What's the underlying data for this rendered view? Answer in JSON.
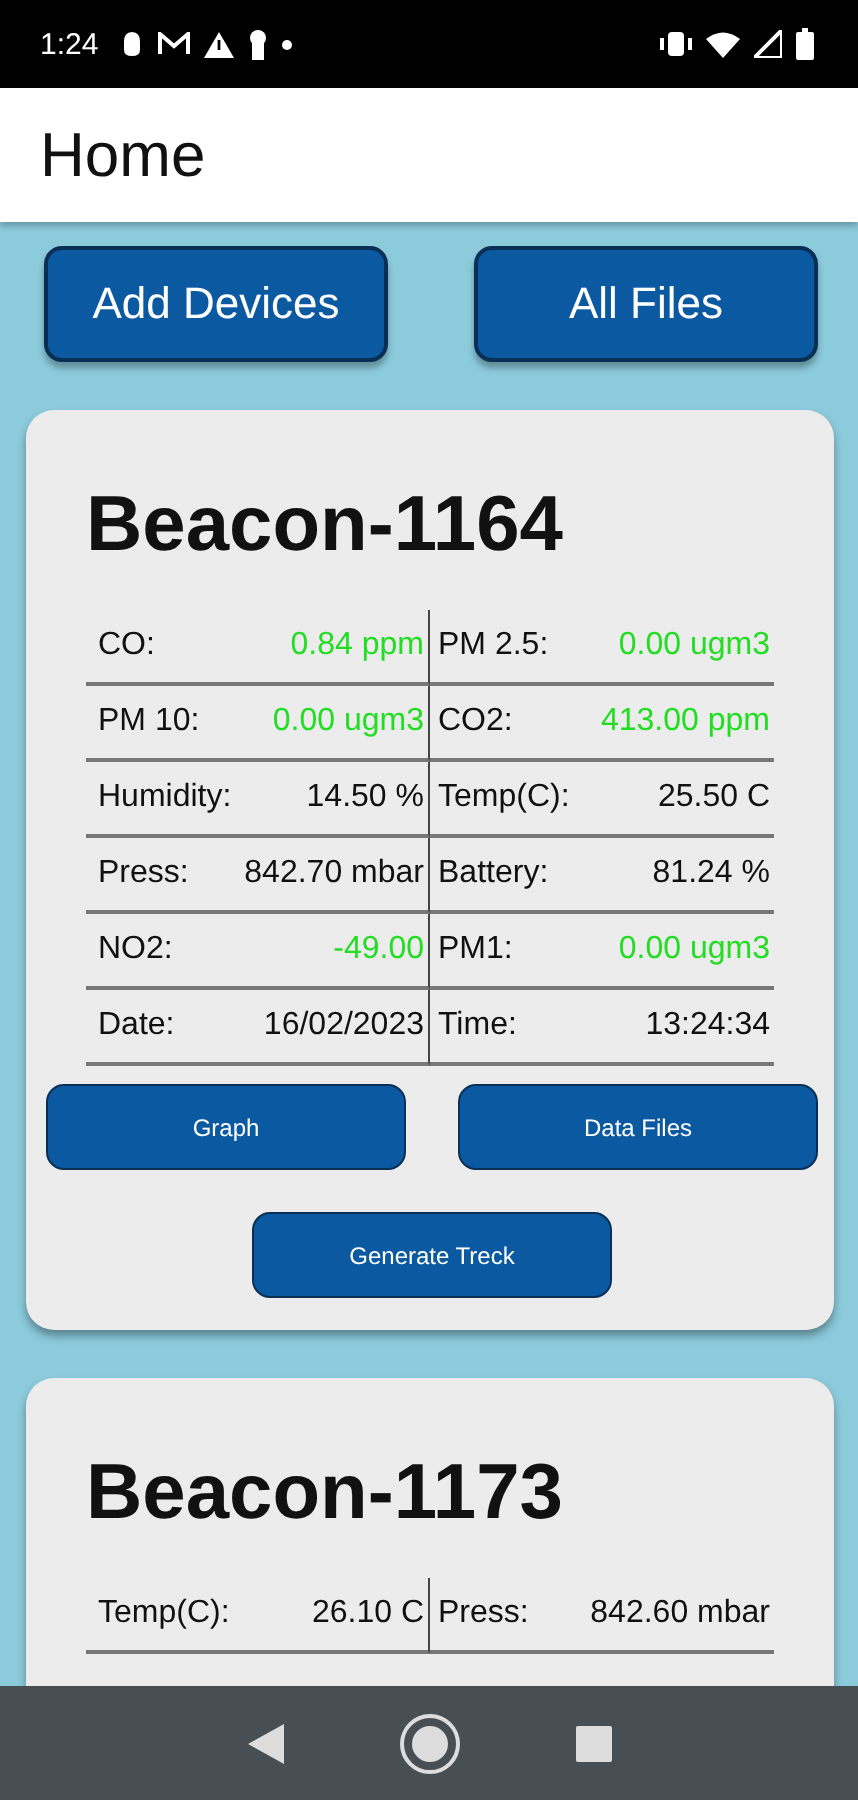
{
  "status_bar": {
    "time": "1:24"
  },
  "app_bar": {
    "title": "Home"
  },
  "actions": [
    "Add Devices",
    "All Files"
  ],
  "devices": [
    {
      "name": "Beacon-1164",
      "readings": [
        {
          "label": "CO:",
          "value": "0.84 ppm",
          "color": "#22dd22"
        },
        {
          "label": "PM 2.5:",
          "value": "0.00 ugm3",
          "color": "#22dd22"
        },
        {
          "label": "PM 10:",
          "value": "0.00 ugm3",
          "color": "#22dd22"
        },
        {
          "label": "CO2:",
          "value": "413.00 ppm",
          "color": "#22dd22"
        },
        {
          "label": "Humidity:",
          "value": "14.50 %",
          "color": "#111111"
        },
        {
          "label": "Temp(C):",
          "value": "25.50 C",
          "color": "#111111"
        },
        {
          "label": "Press:",
          "value": "842.70 mbar",
          "color": "#111111"
        },
        {
          "label": "Battery:",
          "value": "81.24 %",
          "color": "#111111"
        },
        {
          "label": "NO2:",
          "value": "-49.00",
          "color": "#22dd22"
        },
        {
          "label": "PM1:",
          "value": "0.00 ugm3",
          "color": "#22dd22"
        },
        {
          "label": "Date:",
          "value": "16/02/2023",
          "color": "#111111"
        },
        {
          "label": "Time:",
          "value": "13:24:34",
          "color": "#111111"
        }
      ],
      "buttons": [
        "Graph",
        "Data Files",
        "Generate Treck"
      ]
    },
    {
      "name": "Beacon-1173",
      "readings": [
        {
          "label": "Temp(C):",
          "value": "26.10 C",
          "color": "#111111"
        },
        {
          "label": "Press:",
          "value": "842.60 mbar",
          "color": "#111111"
        }
      ]
    }
  ]
}
